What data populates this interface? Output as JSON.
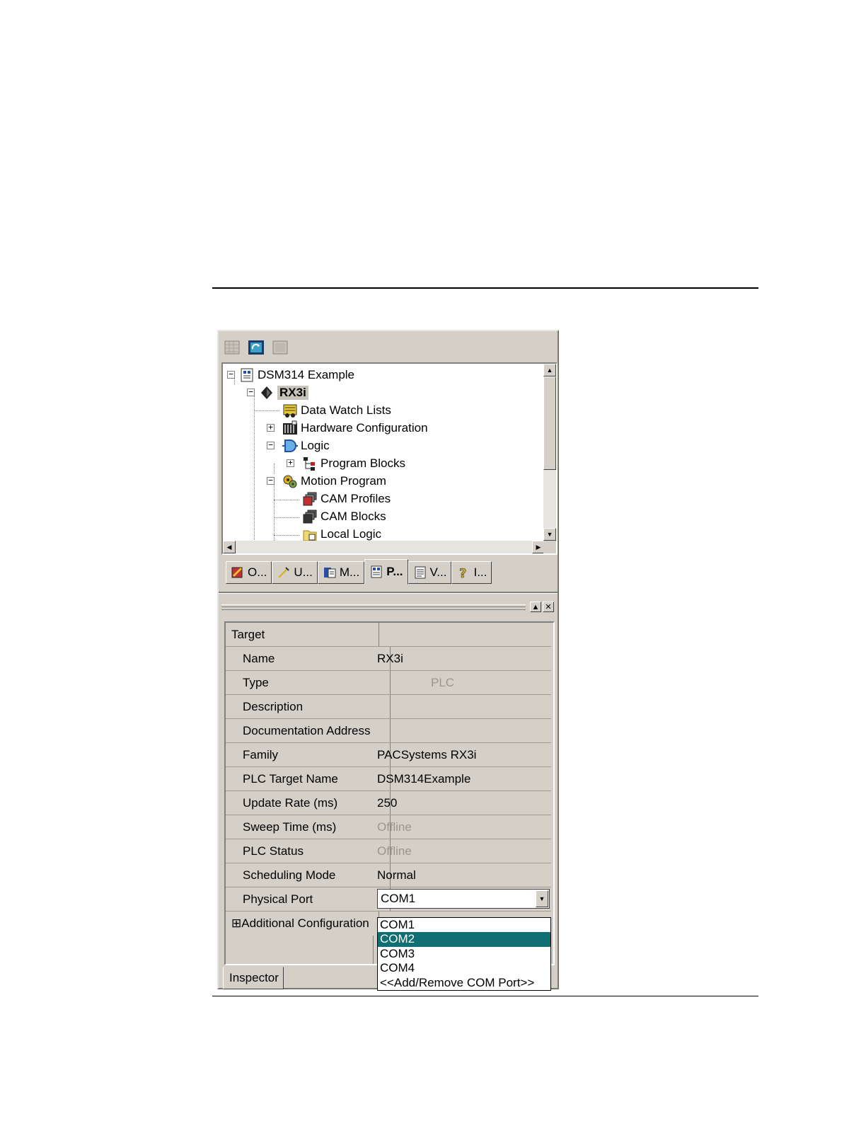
{
  "toolbar": {
    "icons": [
      "grid-icon",
      "refresh-icon",
      "blank-icon"
    ]
  },
  "tree": {
    "items": [
      {
        "label": "DSM314 Example",
        "icon": "project-icon"
      },
      {
        "label": "RX3i",
        "icon": "target-icon"
      },
      {
        "label": "Data Watch Lists",
        "icon": "data-watch-icon"
      },
      {
        "label": "Hardware Configuration",
        "icon": "hardware-icon"
      },
      {
        "label": "Logic",
        "icon": "logic-icon"
      },
      {
        "label": "Program Blocks",
        "icon": "program-blocks-icon"
      },
      {
        "label": "Motion Program",
        "icon": "motion-icon"
      },
      {
        "label": "CAM Profiles",
        "icon": "cam-profiles-icon"
      },
      {
        "label": "CAM Blocks",
        "icon": "cam-blocks-icon"
      },
      {
        "label": "Local Logic",
        "icon": "local-logic-icon"
      }
    ]
  },
  "tabs": [
    {
      "label": "O...",
      "icon": "options-icon"
    },
    {
      "label": "U...",
      "icon": "utilities-icon"
    },
    {
      "label": "M...",
      "icon": "manuals-icon"
    },
    {
      "label": "P...",
      "icon": "project-icon"
    },
    {
      "label": "V...",
      "icon": "variables-icon"
    },
    {
      "label": "I...",
      "icon": "help-icon"
    }
  ],
  "inspector": {
    "header": "Target",
    "rows": [
      {
        "name": "Name",
        "value": "RX3i"
      },
      {
        "name": "Type",
        "value": "PLC"
      },
      {
        "name": "Description",
        "value": ""
      },
      {
        "name": "Documentation Address",
        "value": ""
      },
      {
        "name": "Family",
        "value": "PACSystems RX3i"
      },
      {
        "name": "PLC Target Name",
        "value": "DSM314Example"
      },
      {
        "name": "Update Rate (ms)",
        "value": "250"
      },
      {
        "name": "Sweep Time (ms)",
        "value": "Offline"
      },
      {
        "name": "PLC Status",
        "value": "Offline"
      },
      {
        "name": "Scheduling Mode",
        "value": "Normal"
      },
      {
        "name": "Physical Port",
        "value": "COM1"
      },
      {
        "name": "⊞Additional Configuration",
        "value": ""
      }
    ],
    "port_options": [
      "COM1",
      "COM2",
      "COM3",
      "COM4",
      "<<Add/Remove COM Port>>"
    ],
    "selected_option": "COM2",
    "bottom_tab": "Inspector"
  },
  "colors": {
    "panel": "#d4d0c8",
    "selection": "#0f6f73"
  }
}
